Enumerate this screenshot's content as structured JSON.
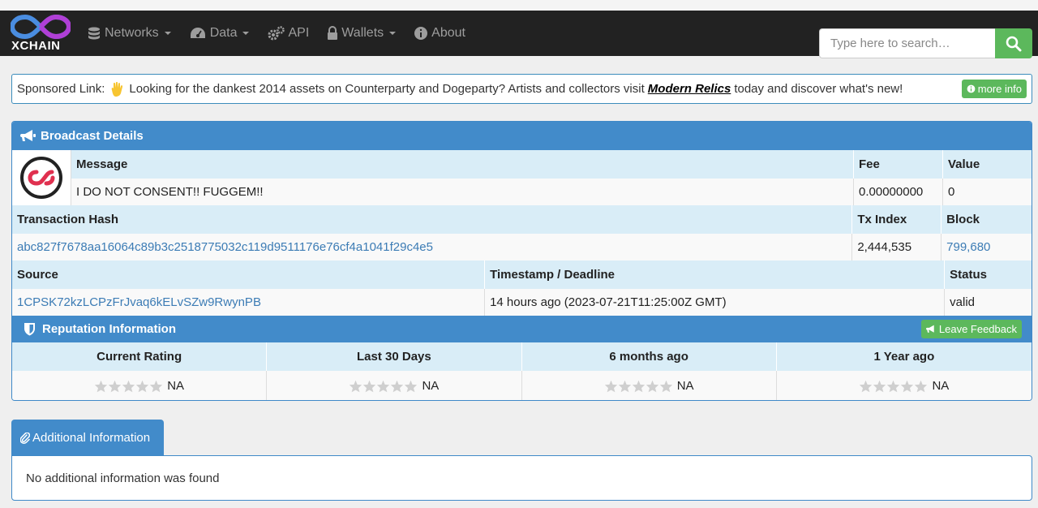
{
  "brand": {
    "name": "XCHAIN"
  },
  "nav": {
    "networks": "Networks",
    "data": "Data",
    "api": "API",
    "wallets": "Wallets",
    "about": "About"
  },
  "search": {
    "placeholder": "Type here to search…"
  },
  "sponsor": {
    "label": "Sponsored Link:",
    "text_before": "Looking for the dankest 2014 assets on Counterparty and Dogeparty? Artists and collectors visit",
    "link": "Modern Relics",
    "text_after": "today and discover what's new!",
    "more_info": "more info"
  },
  "broadcast": {
    "title": "Broadcast Details",
    "headers": {
      "message": "Message",
      "fee": "Fee",
      "value": "Value",
      "tx_hash": "Transaction Hash",
      "tx_index": "Tx Index",
      "block": "Block",
      "source": "Source",
      "timestamp": "Timestamp / Deadline",
      "status": "Status"
    },
    "message": "I DO NOT CONSENT!! FUGGEM!!",
    "fee": "0.00000000",
    "value": "0",
    "tx_hash": "abc827f7678aa16064c89b3c2518775032c119d9511176e76cf4a1041f29c4e5",
    "tx_index": "2,444,535",
    "block": "799,680",
    "source": "1CPSK72kzLCPzFrJvaq6kELvSZw9RwynPB",
    "timestamp": "14 hours ago (2023-07-21T11:25:00Z GMT)",
    "status": "valid"
  },
  "reputation": {
    "title": "Reputation Information",
    "leave_feedback": "Leave Feedback",
    "columns": [
      "Current Rating",
      "Last 30 Days",
      "6 months ago",
      "1 Year ago"
    ],
    "values": [
      "NA",
      "NA",
      "NA",
      "NA"
    ]
  },
  "additional": {
    "tab": "Additional Information",
    "text": "No additional information was found"
  },
  "colors": {
    "navbar": "#222222",
    "accent": "#428bca",
    "success": "#5cb85c",
    "header_row": "#d9edf7"
  }
}
